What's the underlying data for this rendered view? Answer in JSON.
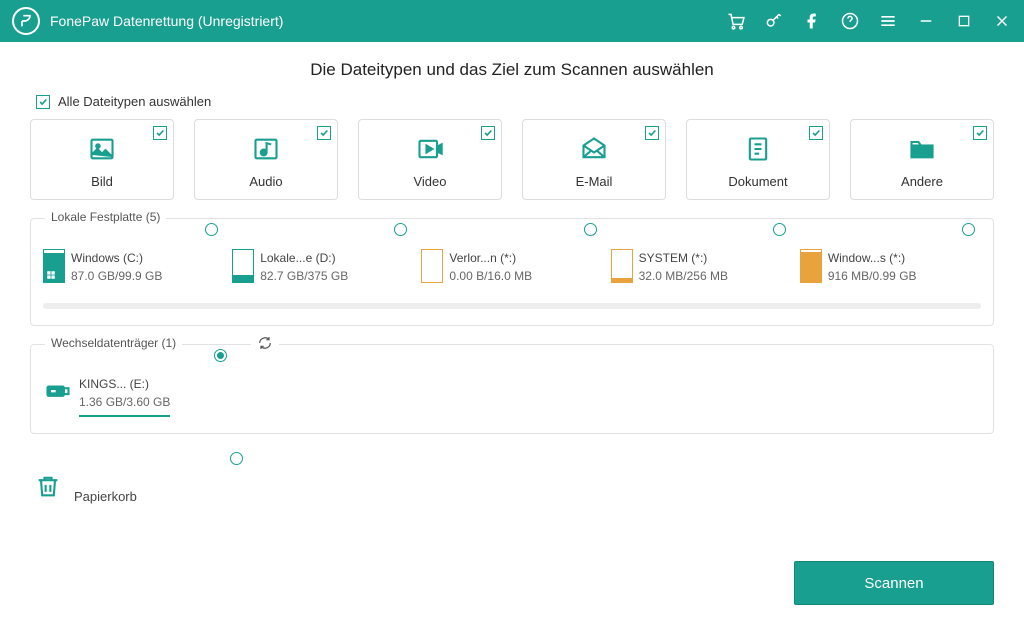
{
  "titlebar": {
    "title": "FonePaw Datenrettung (Unregistriert)"
  },
  "heading": "Die Dateitypen und das Ziel zum Scannen auswählen",
  "selectall_label": "Alle Dateitypen auswählen",
  "types": {
    "bild": "Bild",
    "audio": "Audio",
    "video": "Video",
    "email": "E-Mail",
    "dokument": "Dokument",
    "andere": "Andere"
  },
  "local_legend": "Lokale Festplatte (5)",
  "drives": {
    "c": {
      "name": "Windows (C:)",
      "size": "87.0 GB/99.9 GB"
    },
    "d": {
      "name": "Lokale...e (D:)",
      "size": "82.7 GB/375 GB"
    },
    "lost": {
      "name": "Verlor...n (*:)",
      "size": "0.00  B/16.0 MB"
    },
    "sys": {
      "name": "SYSTEM (*:)",
      "size": "32.0 MB/256 MB"
    },
    "win": {
      "name": "Window...s (*:)",
      "size": "916 MB/0.99 GB"
    }
  },
  "removable_legend": "Wechseldatenträger (1)",
  "usb": {
    "name": "KINGS... (E:)",
    "size": "1.36 GB/3.60 GB"
  },
  "trash_label": "Papierkorb",
  "scan_label": "Scannen"
}
